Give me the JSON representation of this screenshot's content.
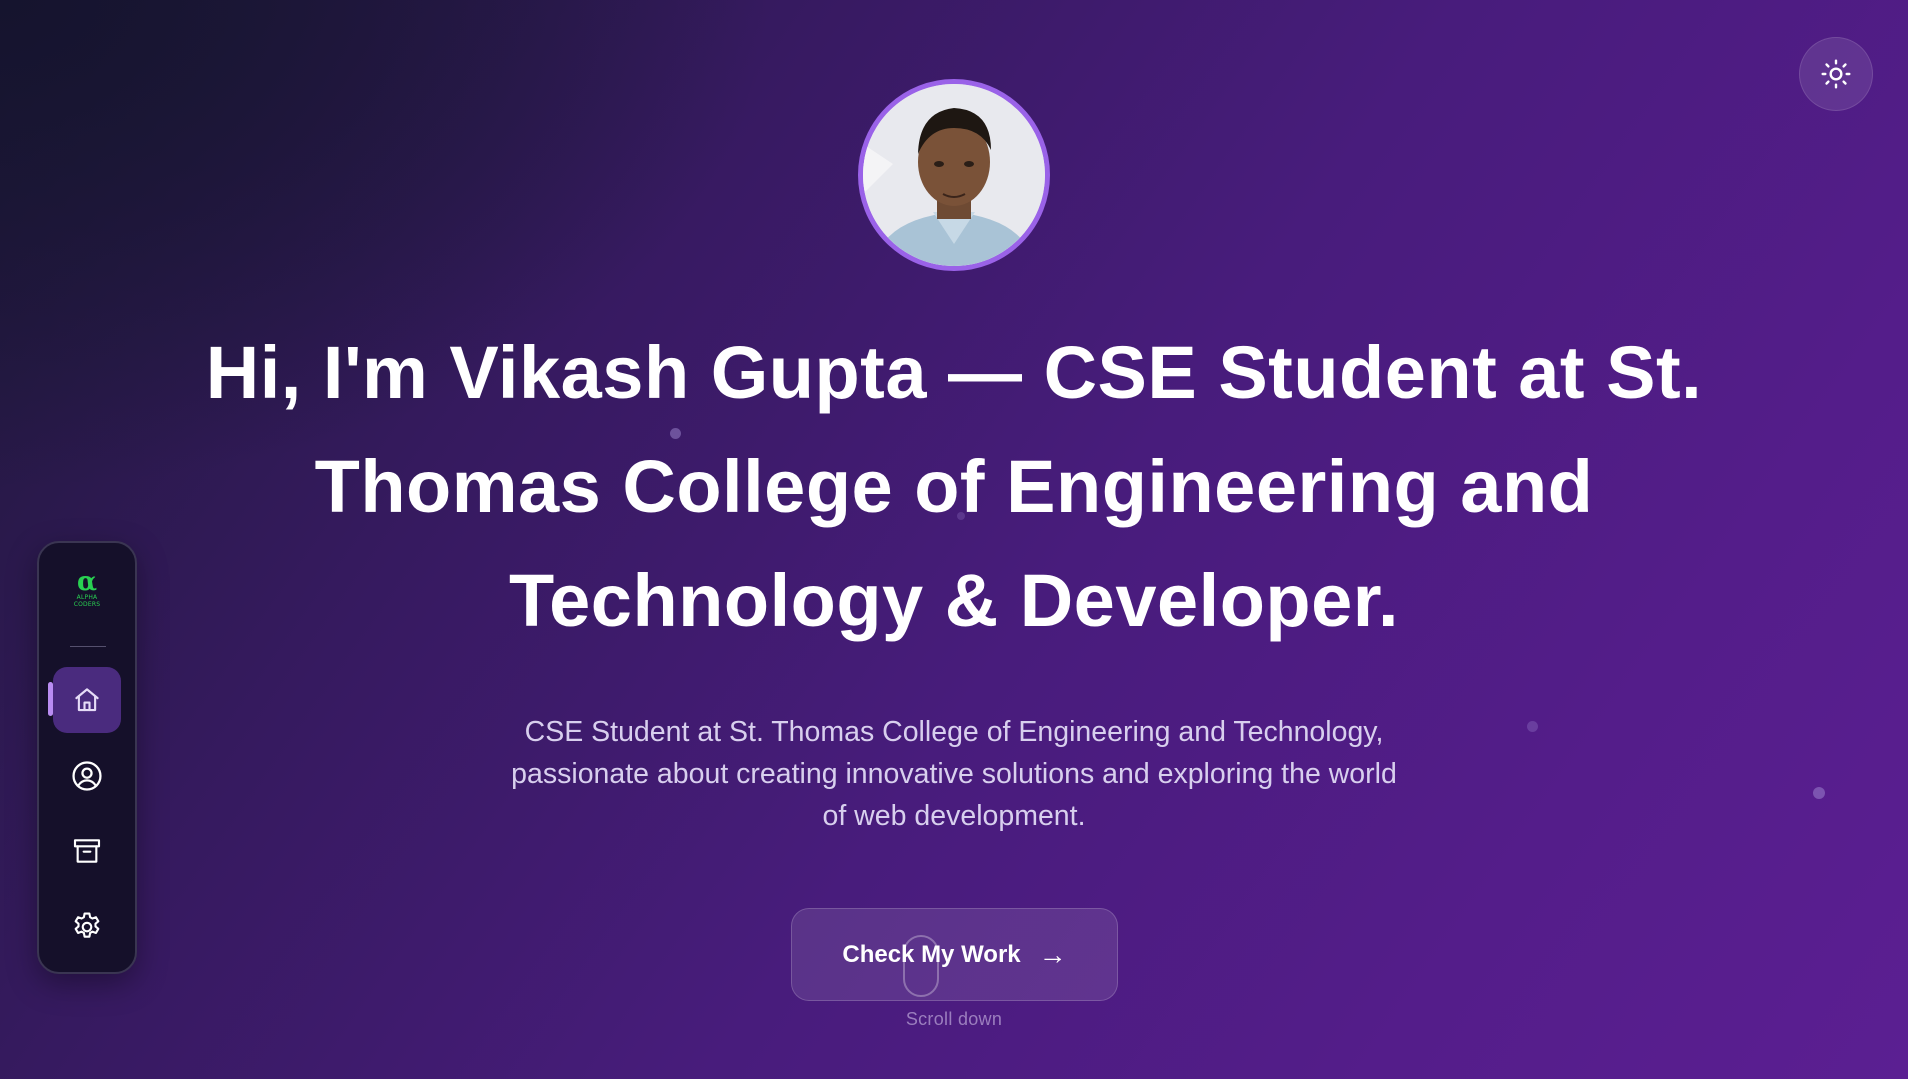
{
  "theme_toggle": {
    "icon": "sun-icon"
  },
  "sidebar": {
    "brand": {
      "symbol": "α",
      "line1": "ALPHA",
      "line2": "CODERS"
    },
    "items": [
      {
        "id": "home",
        "icon": "home-icon",
        "active": true
      },
      {
        "id": "profile",
        "icon": "user-circle-icon",
        "active": false
      },
      {
        "id": "archive",
        "icon": "archive-icon",
        "active": false
      },
      {
        "id": "settings",
        "icon": "gear-icon",
        "active": false
      }
    ]
  },
  "hero": {
    "headline_line1": "Hi, I'm Vikash Gupta — CSE Student at St.",
    "headline_line2": "Thomas College of Engineering and",
    "headline_line3": "Technology & Developer.",
    "subtitle_line1": "CSE Student at St. Thomas College of Engineering and Technology,",
    "subtitle_line2": "passionate about creating innovative solutions and exploring the world",
    "subtitle_line3": "of web development.",
    "cta_label": "Check My Work",
    "cta_arrow": "→",
    "scroll_label": "Scroll down"
  },
  "colors": {
    "background_start": "#1e1838",
    "background_end": "#5b1f92",
    "accent": "#9a62e8",
    "active_nav": "#4a2b7e",
    "brand_green": "#29d152"
  }
}
